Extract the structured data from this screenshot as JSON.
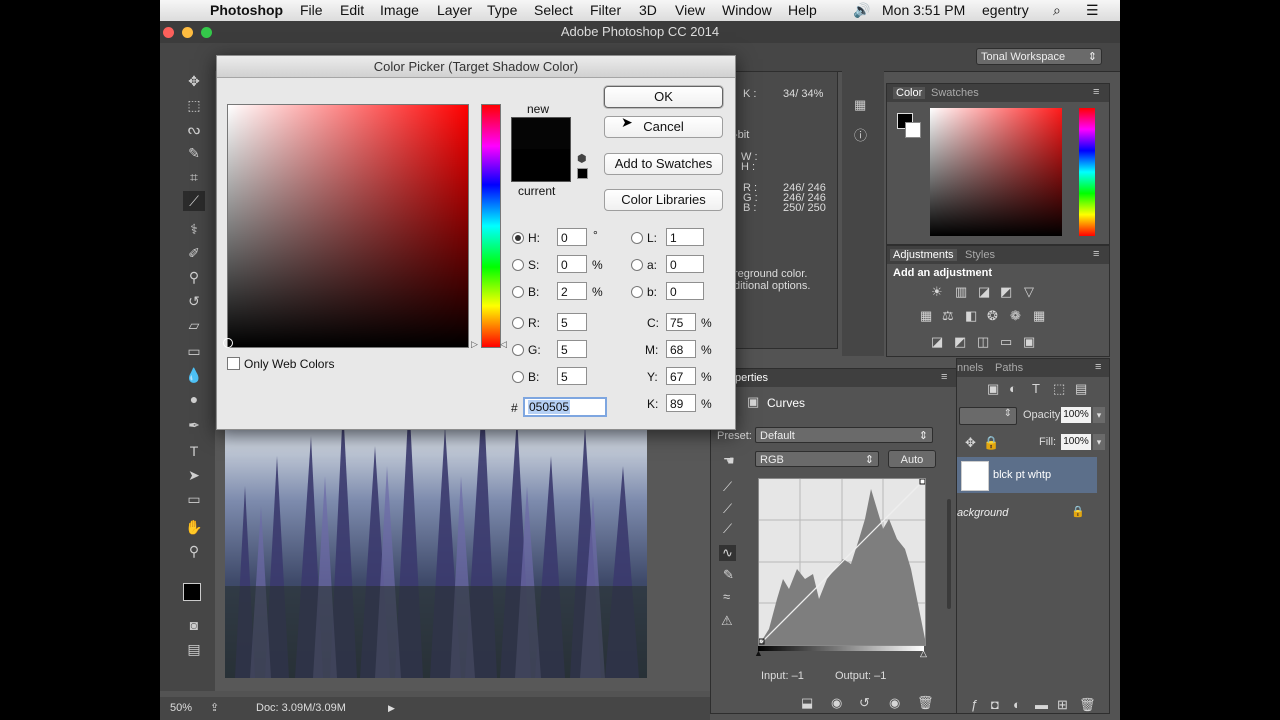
{
  "menubar": {
    "app": "Photoshop",
    "items": [
      "File",
      "Edit",
      "Image",
      "Layer",
      "Type",
      "Select",
      "Filter",
      "3D",
      "View",
      "Window",
      "Help"
    ],
    "clock": "Mon 3:51 PM",
    "user": "egentry"
  },
  "window": {
    "title": "Adobe Photoshop CC 2014"
  },
  "workspace": {
    "label": "Tonal Workspace"
  },
  "info_panel": {
    "k_label": "K :",
    "k_value": "34/  34%",
    "bit": "-bit",
    "w": "W :",
    "h": "H :",
    "r": "R :",
    "r_value": "246/  246",
    "g": "G :",
    "g_value": "246/  246",
    "b": "B :",
    "b_value": "250/  250",
    "hint1": "reground color.",
    "hint2": "ditional options."
  },
  "color_panel": {
    "tab_color": "Color",
    "tab_swatches": "Swatches"
  },
  "adjustments_panel": {
    "tab_adjustments": "Adjustments",
    "tab_styles": "Styles",
    "heading": "Add an adjustment"
  },
  "layers_panel": {
    "tab_channels": "nnels",
    "tab_paths": "Paths",
    "opacity_label": "Opacity:",
    "opacity_value": "100%",
    "fill_label": "Fill:",
    "fill_value": "100%",
    "layer1": "blck pt whtp",
    "layer2": "ackground"
  },
  "properties_panel": {
    "tab": "perties",
    "title": "Curves",
    "preset_label": "Preset:",
    "preset_value": "Default",
    "channel_value": "RGB",
    "auto_label": "Auto",
    "input_label": "Input: –1",
    "output_label": "Output: –1"
  },
  "status": {
    "zoom": "50%",
    "doc": "Doc: 3.09M/3.09M"
  },
  "color_picker": {
    "title": "Color Picker (Target Shadow Color)",
    "new_label": "new",
    "current_label": "current",
    "ok": "OK",
    "cancel": "Cancel",
    "add_to_swatches": "Add to Swatches",
    "color_libraries": "Color Libraries",
    "only_web_colors": "Only Web Colors",
    "H": {
      "label": "H:",
      "value": "0",
      "unit": "°"
    },
    "S": {
      "label": "S:",
      "value": "0",
      "unit": "%"
    },
    "B": {
      "label": "B:",
      "value": "2",
      "unit": "%"
    },
    "R": {
      "label": "R:",
      "value": "5"
    },
    "G": {
      "label": "G:",
      "value": "5"
    },
    "Bl": {
      "label": "B:",
      "value": "5"
    },
    "L": {
      "label": "L:",
      "value": "1"
    },
    "a": {
      "label": "a:",
      "value": "0"
    },
    "b": {
      "label": "b:",
      "value": "0"
    },
    "C": {
      "label": "C:",
      "value": "75",
      "unit": "%"
    },
    "M": {
      "label": "M:",
      "value": "68",
      "unit": "%"
    },
    "Y": {
      "label": "Y:",
      "value": "67",
      "unit": "%"
    },
    "K": {
      "label": "K:",
      "value": "89",
      "unit": "%"
    },
    "hash": "#",
    "hex": "050505",
    "new_color": "#050505",
    "current_color": "#000000"
  },
  "colors": {
    "accent": "#3c6fb8",
    "hue_red": "#ff0000"
  }
}
